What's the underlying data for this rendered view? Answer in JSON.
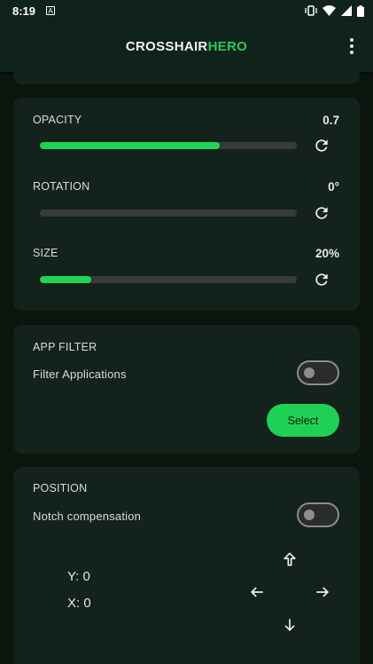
{
  "status_bar": {
    "time": "8:19",
    "notification_icon": "A"
  },
  "app_bar": {
    "title_part1": "CROSSHAIR",
    "title_part2": "HERO",
    "menu_icon": "more-vert-icon"
  },
  "sliders": [
    {
      "label": "OPACITY",
      "value": "0.7",
      "fill_fraction": 0.7
    },
    {
      "label": "ROTATION",
      "value": "0°",
      "fill_fraction": 0.0
    },
    {
      "label": "SIZE",
      "value": "20%",
      "fill_fraction": 0.2
    }
  ],
  "app_filter": {
    "heading": "APP FILTER",
    "toggle_label": "Filter Applications",
    "toggle_on": false,
    "select_label": "Select"
  },
  "position": {
    "heading": "POSITION",
    "toggle_label": "Notch compensation",
    "toggle_on": false,
    "y_text": "Y: 0",
    "x_text": "X: 0"
  },
  "colors": {
    "accent": "#1fd455",
    "background": "#0b150e",
    "card": "#13221a"
  }
}
